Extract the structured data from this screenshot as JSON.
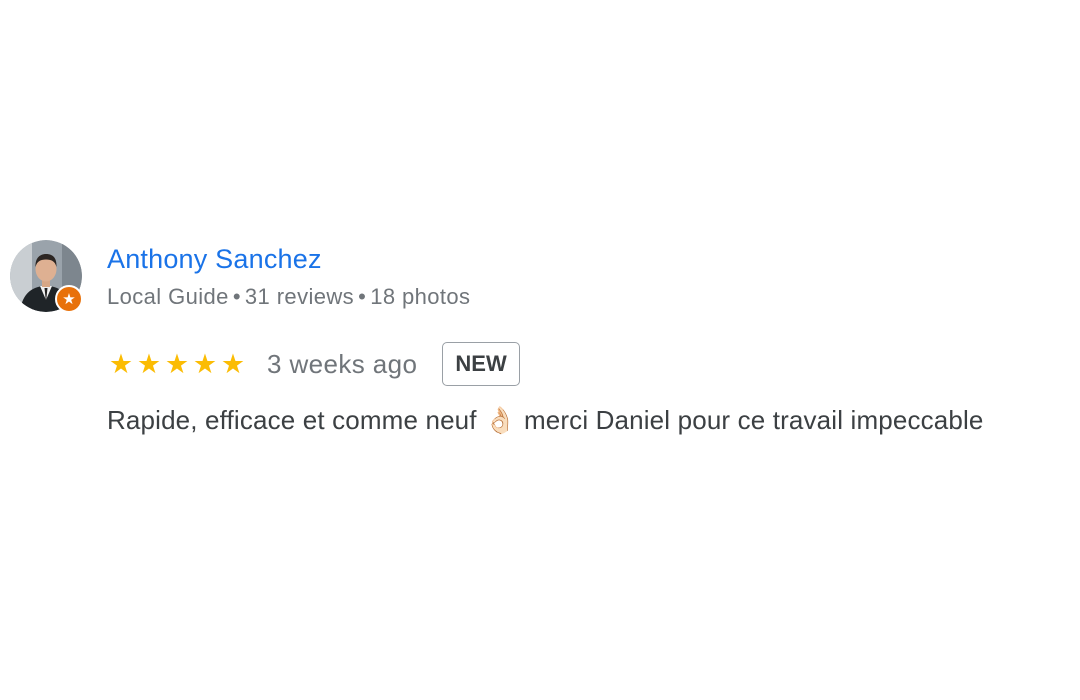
{
  "review": {
    "author_name": "Anthony Sanchez",
    "author_meta": {
      "badge": "Local Guide",
      "reviews": "31 reviews",
      "photos": "18 photos",
      "separator": "•"
    },
    "rating": 5,
    "rating_max": 5,
    "time": "3 weeks ago",
    "new_label": "NEW",
    "text": "Rapide, efficace et comme neuf 👌🏻 merci Daniel pour ce travail impeccable"
  },
  "icons": {
    "avatar": "user-avatar-photo",
    "guide_badge": "local-guide-star-icon",
    "star": "star-icon"
  },
  "colors": {
    "author_link": "#1a73e8",
    "meta_text": "#70757a",
    "star": "#fbbc04",
    "guide_badge": "#e8710a",
    "body_text": "#3c4043"
  }
}
